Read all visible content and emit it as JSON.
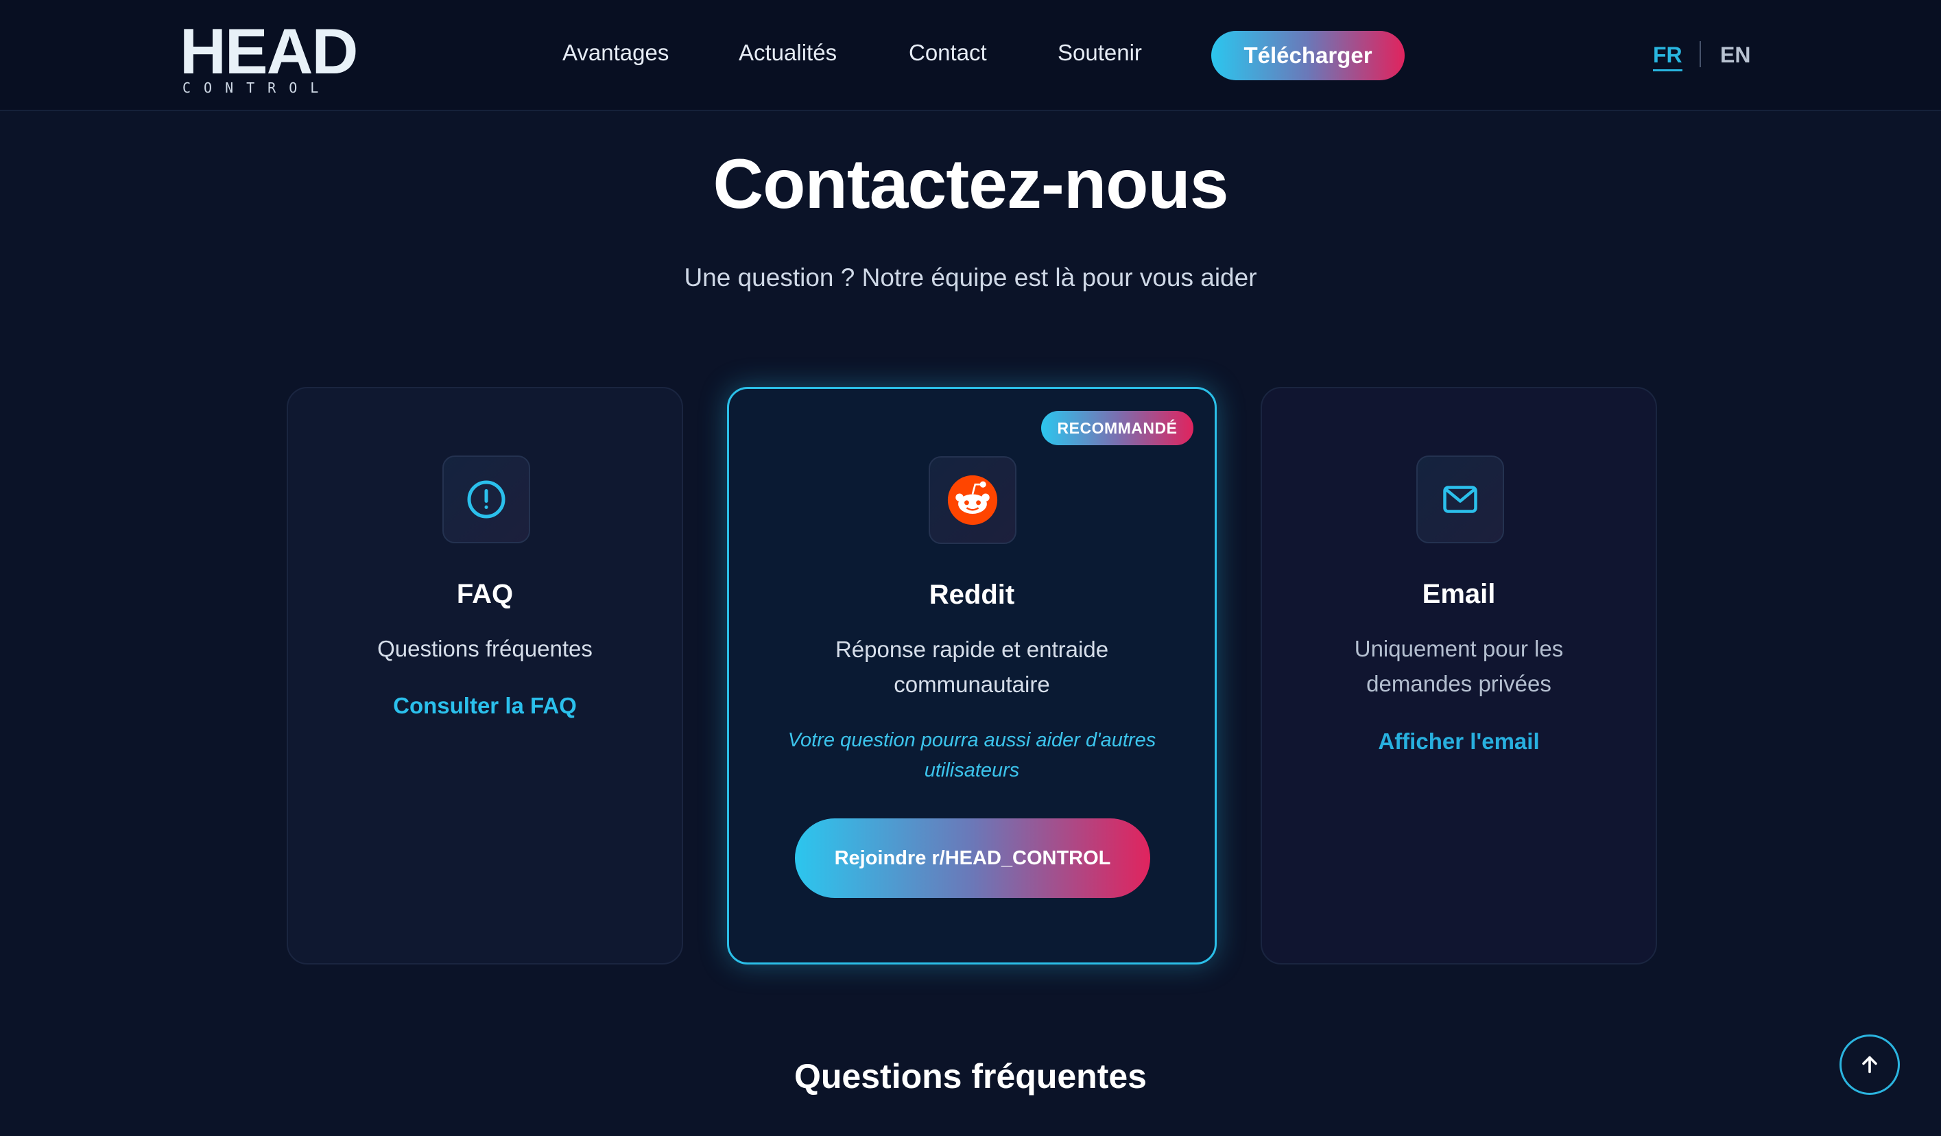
{
  "header": {
    "logo": {
      "main": "HEAD",
      "sub": "CONTROL"
    },
    "nav": [
      "Avantages",
      "Actualités",
      "Contact",
      "Soutenir"
    ],
    "download_label": "Télécharger",
    "languages": {
      "fr": "FR",
      "en": "EN",
      "active": "FR"
    }
  },
  "hero": {
    "title": "Contactez-nous",
    "subtitle": "Une question ? Notre équipe est là pour vous aider"
  },
  "cards": {
    "faq": {
      "icon": "alert-circle-icon",
      "name": "FAQ",
      "description": "Questions fréquentes",
      "link": "Consulter la FAQ"
    },
    "reddit": {
      "icon": "reddit-icon",
      "badge": "RECOMMANDÉ",
      "name": "Reddit",
      "description": "Réponse rapide et entraide communautaire",
      "note": "Votre question pourra aussi aider d'autres utilisateurs",
      "button": "Rejoindre r/HEAD_CONTROL"
    },
    "email": {
      "icon": "mail-icon",
      "name": "Email",
      "description": "Uniquement pour les demandes privées",
      "link": "Afficher l'email"
    }
  },
  "faq_section": {
    "title": "Questions fréquentes"
  },
  "colors": {
    "accent_cyan": "#2bc0ec",
    "accent_pink": "#e0245e",
    "background": "#0b1328",
    "reddit_orange": "#ff4500"
  }
}
